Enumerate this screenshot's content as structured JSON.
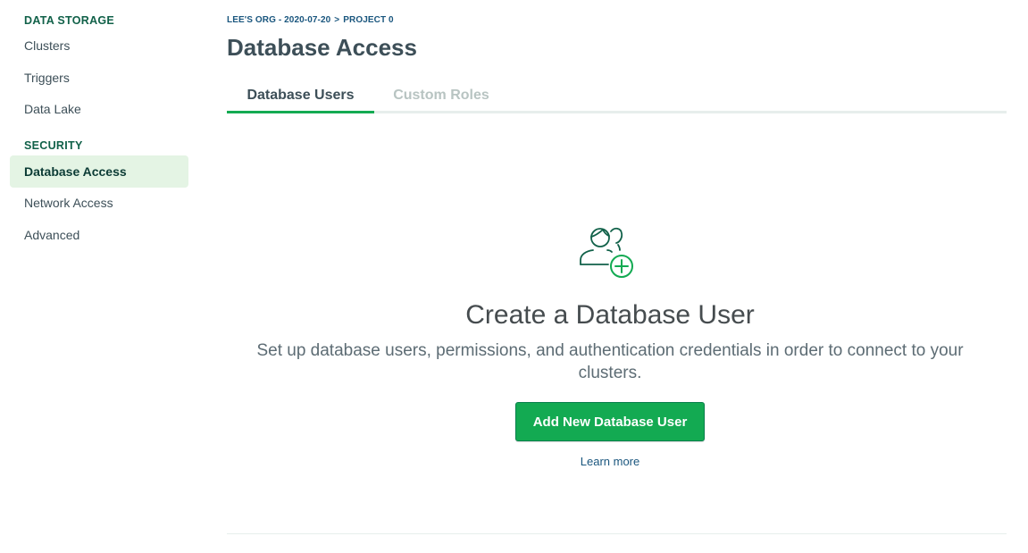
{
  "sidebar": {
    "sections": [
      {
        "heading": "DATA STORAGE",
        "items": [
          {
            "label": "Clusters"
          },
          {
            "label": "Triggers"
          },
          {
            "label": "Data Lake"
          }
        ]
      },
      {
        "heading": "SECURITY",
        "items": [
          {
            "label": "Database Access"
          },
          {
            "label": "Network Access"
          },
          {
            "label": "Advanced"
          }
        ]
      }
    ]
  },
  "breadcrumb": {
    "org": "LEE'S ORG - 2020-07-20",
    "separator": ">",
    "project": "PROJECT 0"
  },
  "page": {
    "title": "Database Access"
  },
  "tabs": [
    {
      "label": "Database Users",
      "active": true
    },
    {
      "label": "Custom Roles",
      "active": false
    }
  ],
  "empty_state": {
    "icon": "add-user-icon",
    "title": "Create a Database User",
    "description": "Set up database users, permissions, and authentication credentials in order to connect to your clusters.",
    "button_label": "Add New Database User",
    "link_label": "Learn more"
  },
  "colors": {
    "accent": "#13aa52",
    "icon_dark": "#116149",
    "link": "#1a567e",
    "active_nav_bg": "#e4f4e4"
  }
}
